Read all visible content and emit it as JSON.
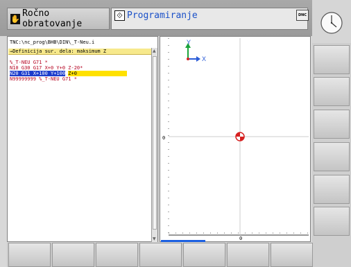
{
  "header": {
    "manual_tab_label": "Ročno obratovanje",
    "manual_icon": "hand-icon",
    "program_tab_label": "Programiranje",
    "program_icon": "program-run-icon",
    "dnc_label": "DNC"
  },
  "editor": {
    "file_path": "TNC:\\nc_prog\\BHB\\DIN\\_T-Neu.i",
    "definition_prompt": "→Definicija sur. dela: maksimum Z",
    "lines": {
      "l1": "%_T-NEU G71 *",
      "l2": "N10 G30 G17 X+0 Y+0 Z-20*",
      "l3_selected": "N20 G31 X+100 Y+100",
      "l3_input": "Z+0",
      "l4": "N99999999 %_T-NEU G71 *"
    }
  },
  "graphics": {
    "axis_y_label": "Y",
    "axis_x_label": "X",
    "vertical_tick_zero": "0",
    "horizontal_tick_zero": "0"
  },
  "colors": {
    "program_tab_text": "#1a50c8",
    "selection_blue": "#1b3ccc",
    "input_yellow": "#ffe100",
    "definition_bar": "#f7e98c",
    "nc_red": "#b4001e",
    "axis_green": "#1aa33a",
    "axis_blue": "#2a5bd7",
    "axis_red": "#d62020"
  }
}
